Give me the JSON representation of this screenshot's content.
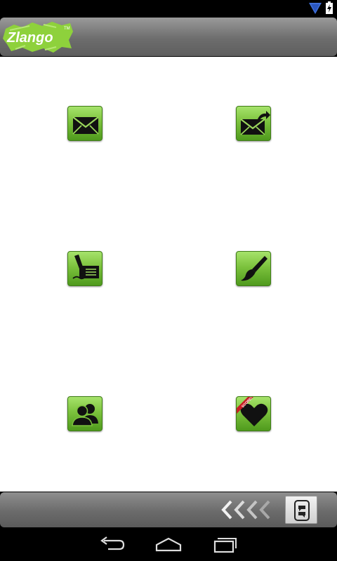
{
  "app": {
    "logo_text": "Zlango",
    "logo_mark": "TM"
  },
  "status_bar": {
    "icons": [
      "wifi-icon",
      "battery-charging-icon"
    ]
  },
  "grid": {
    "tiles": [
      {
        "icon": "envelope-icon"
      },
      {
        "icon": "envelope-forward-icon"
      },
      {
        "icon": "compose-pen-icon"
      },
      {
        "icon": "paintbrush-icon"
      },
      {
        "icon": "contacts-icon"
      },
      {
        "icon": "heart-icon",
        "ribbon": "SCORE!"
      }
    ]
  },
  "footer": {
    "icons": [
      "chevrons-left-icon",
      "chat-switch-icon"
    ]
  },
  "nav": {
    "icons": [
      "back-icon",
      "home-icon",
      "recent-apps-icon"
    ]
  },
  "colors": {
    "tile_green": "#7cc23d",
    "logo_green": "#8ed13c",
    "header_gray": "#6d6d6d",
    "wifi_blue": "#3f6fd8"
  }
}
